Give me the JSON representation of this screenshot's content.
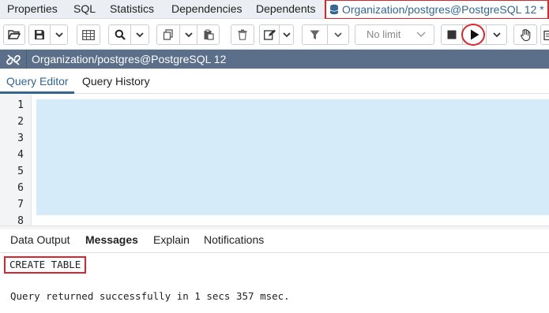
{
  "top_tabs": {
    "properties": "Properties",
    "sql": "SQL",
    "statistics": "Statistics",
    "dependencies": "Dependencies",
    "dependents": "Dependents",
    "query_tab": "Organization/postgres@PostgreSQL 12 *"
  },
  "toolbar": {
    "limit_select": "No limit",
    "icons": [
      "folder-open-icon",
      "save-icon",
      "chevron-down-icon",
      "grid-icon",
      "search-icon",
      "copy-icon",
      "paste-icon",
      "trash-icon",
      "edit-icon",
      "filter-icon",
      "stop-icon",
      "play-icon",
      "hand-icon"
    ]
  },
  "connection": {
    "title": "Organization/postgres@PostgreSQL 12"
  },
  "editor_tabs": {
    "query_editor": "Query Editor",
    "query_history": "Query History"
  },
  "editor": {
    "line_numbers": [
      "1",
      "2",
      "3",
      "4",
      "5",
      "6",
      "7",
      "8"
    ]
  },
  "result_tabs": {
    "data_output": "Data Output",
    "messages": "Messages",
    "explain": "Explain",
    "notifications": "Notifications"
  },
  "messages": {
    "status": "CREATE TABLE",
    "detail": "Query returned successfully in 1 secs 357 msec."
  },
  "colors": {
    "accent": "#326690",
    "highlight": "#d9262c",
    "connection_bar": "#5b6f8a",
    "selection": "#d6ebf9"
  }
}
